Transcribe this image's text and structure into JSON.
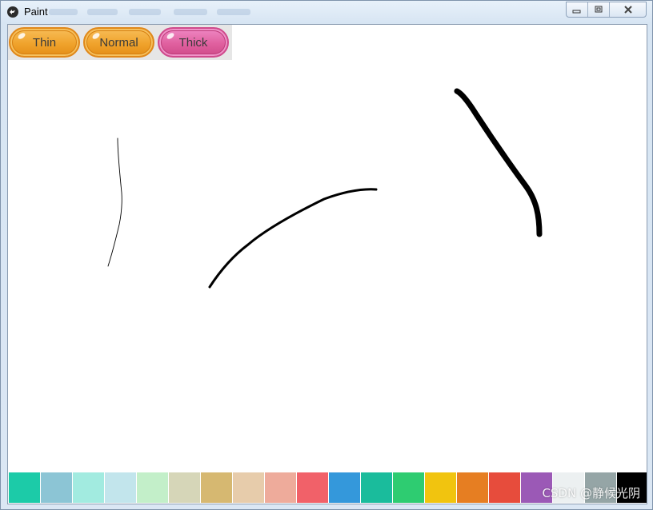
{
  "window": {
    "title": "Paint",
    "icon": "kivy-logo-icon"
  },
  "toolbar": {
    "buttons": [
      {
        "label": "Thin",
        "style": "orange",
        "color": "#f0a32c"
      },
      {
        "label": "Normal",
        "style": "orange",
        "color": "#f0a32c"
      },
      {
        "label": "Thick",
        "style": "pink",
        "color": "#e0609f"
      }
    ]
  },
  "canvas": {
    "strokes": [
      {
        "name": "thin-stroke",
        "color": "#000000",
        "width": "thin"
      },
      {
        "name": "normal-stroke",
        "color": "#000000",
        "width": "normal"
      },
      {
        "name": "thick-stroke",
        "color": "#000000",
        "width": "thick"
      }
    ]
  },
  "palette": {
    "colors": [
      "#1ccba8",
      "#8cc5d5",
      "#a2ebe0",
      "#c2e5ec",
      "#c3efc9",
      "#d6d6b8",
      "#d6b871",
      "#e7ccab",
      "#eeab9b",
      "#f16169",
      "#3498db",
      "#1abc9c",
      "#2ecc71",
      "#f1c40f",
      "#e67e22",
      "#e74c3c",
      "#9b59b6",
      "#ecf0f1",
      "#95a5a6",
      "#000000"
    ]
  },
  "watermark": "CSDN @静候光阴"
}
